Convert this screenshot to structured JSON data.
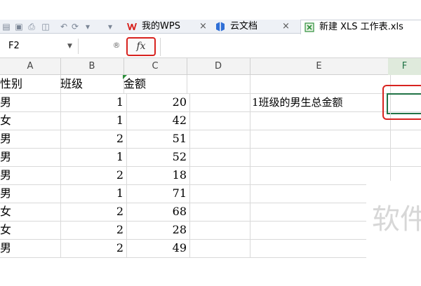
{
  "tabs": [
    {
      "label": "我的WPS",
      "icon": "wps-logo-icon",
      "active": false
    },
    {
      "label": "云文档",
      "icon": "cloud-doc-icon",
      "active": false
    },
    {
      "label": "新建 XLS 工作表.xls",
      "icon": "xls-file-icon",
      "active": true
    }
  ],
  "formula_bar": {
    "name_box": "F2",
    "fx_label": "fx",
    "formula": ""
  },
  "columns": [
    "A",
    "B",
    "C",
    "D",
    "E",
    "F"
  ],
  "rows": [
    {
      "a": "性别",
      "b": "班级",
      "c": "金额",
      "e": ""
    },
    {
      "a": "男",
      "b": "1",
      "c": "20",
      "e": "1班级的男生总金额"
    },
    {
      "a": "女",
      "b": "1",
      "c": "42",
      "e": ""
    },
    {
      "a": "男",
      "b": "2",
      "c": "51",
      "e": ""
    },
    {
      "a": "男",
      "b": "1",
      "c": "52",
      "e": ""
    },
    {
      "a": "男",
      "b": "2",
      "c": "18",
      "e": ""
    },
    {
      "a": "男",
      "b": "1",
      "c": "71",
      "e": ""
    },
    {
      "a": "女",
      "b": "2",
      "c": "68",
      "e": ""
    },
    {
      "a": "女",
      "b": "2",
      "c": "28",
      "e": ""
    },
    {
      "a": "男",
      "b": "2",
      "c": "49",
      "e": ""
    }
  ],
  "selected_cell": "F2",
  "watermark": "软件",
  "colors": {
    "highlight_red": "#d8231f",
    "selection_green": "#217346"
  }
}
